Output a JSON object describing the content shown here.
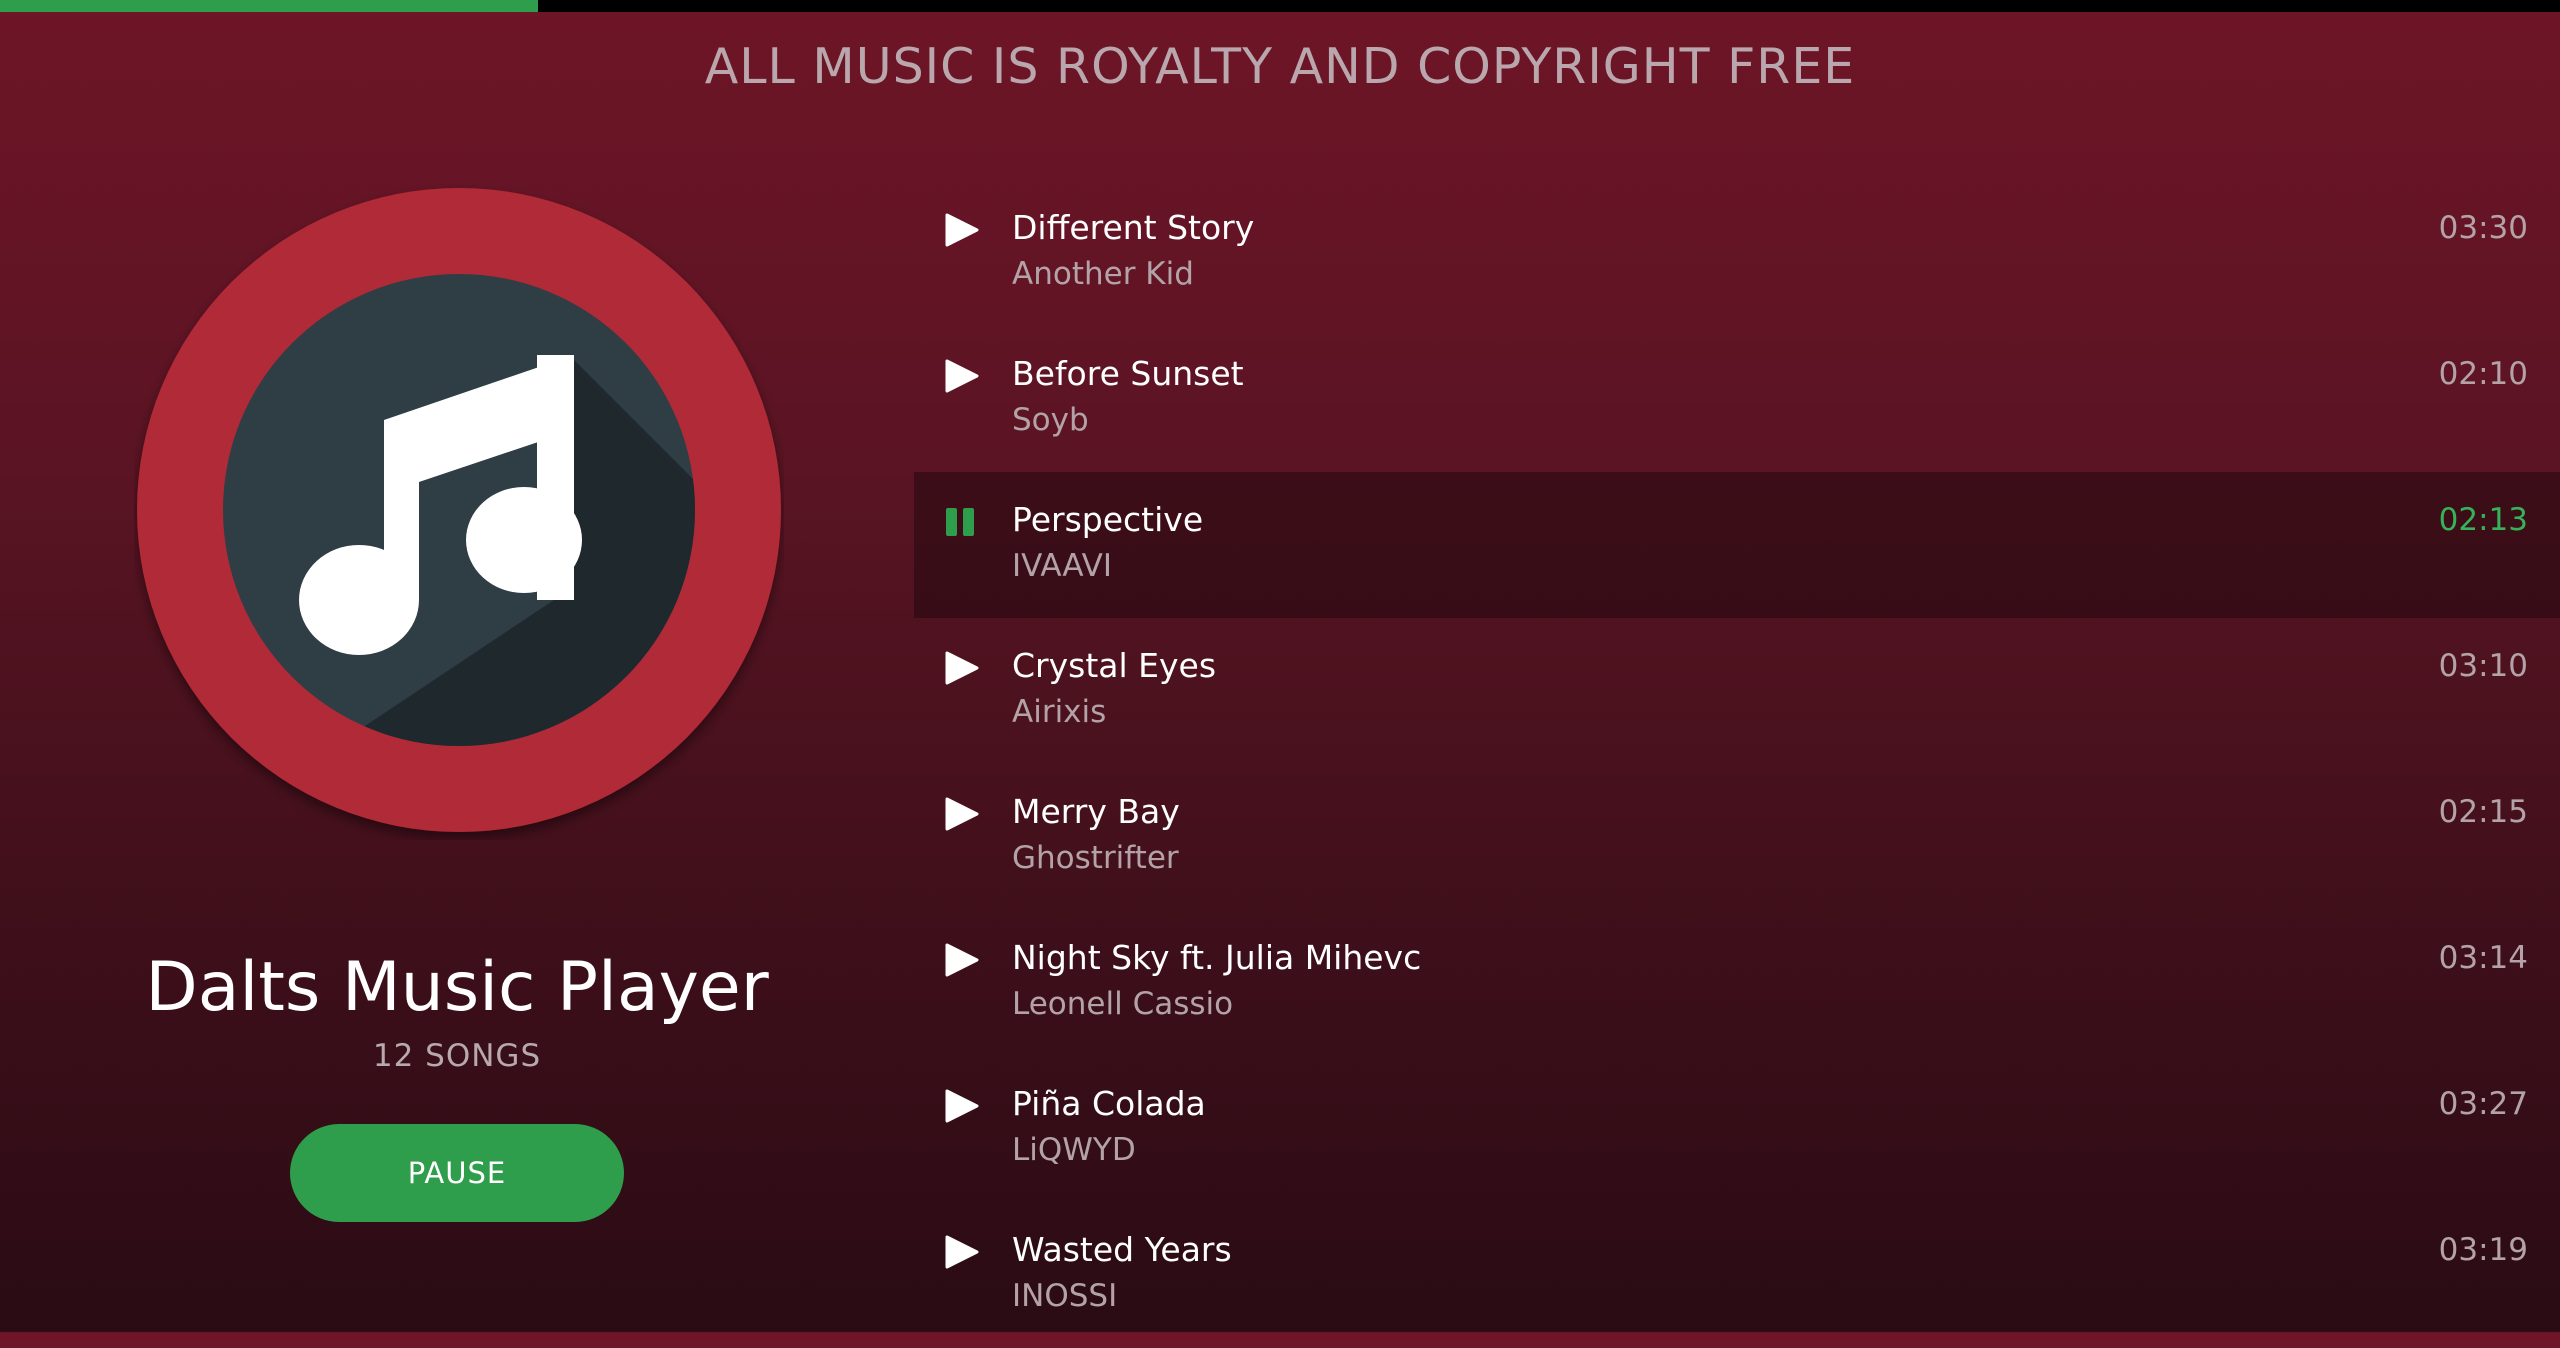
{
  "playback": {
    "progress_fraction": 0.21
  },
  "banner": "ALL MUSIC IS ROYALTY AND COPYRIGHT FREE",
  "player": {
    "title": "Dalts Music Player",
    "song_count": "12 SONGS",
    "pause_label": "PAUSE"
  },
  "tracks": [
    {
      "title": "Different Story",
      "artist": "Another Kid",
      "duration": "03:30",
      "state": "play"
    },
    {
      "title": "Before Sunset",
      "artist": "Soyb",
      "duration": "02:10",
      "state": "play"
    },
    {
      "title": "Perspective",
      "artist": "IVAAVI",
      "duration": "02:13",
      "state": "playing"
    },
    {
      "title": "Crystal Eyes",
      "artist": "Airixis",
      "duration": "03:10",
      "state": "play"
    },
    {
      "title": "Merry Bay",
      "artist": "Ghostrifter",
      "duration": "02:15",
      "state": "play"
    },
    {
      "title": "Night Sky ft. Julia Mihevc",
      "artist": "Leonell Cassio",
      "duration": "03:14",
      "state": "play"
    },
    {
      "title": "Piña Colada",
      "artist": "LiQWYD",
      "duration": "03:27",
      "state": "play"
    },
    {
      "title": "Wasted Years",
      "artist": "INOSSI",
      "duration": "03:19",
      "state": "play"
    }
  ],
  "icons": {
    "play": "play-icon",
    "pause": "pause-icon",
    "logo": "music-note-icon"
  },
  "colors": {
    "accent": "#2e9e4c",
    "active_duration": "#36b25a",
    "logo_ring": "#b02a37",
    "logo_disc": "#263238"
  }
}
